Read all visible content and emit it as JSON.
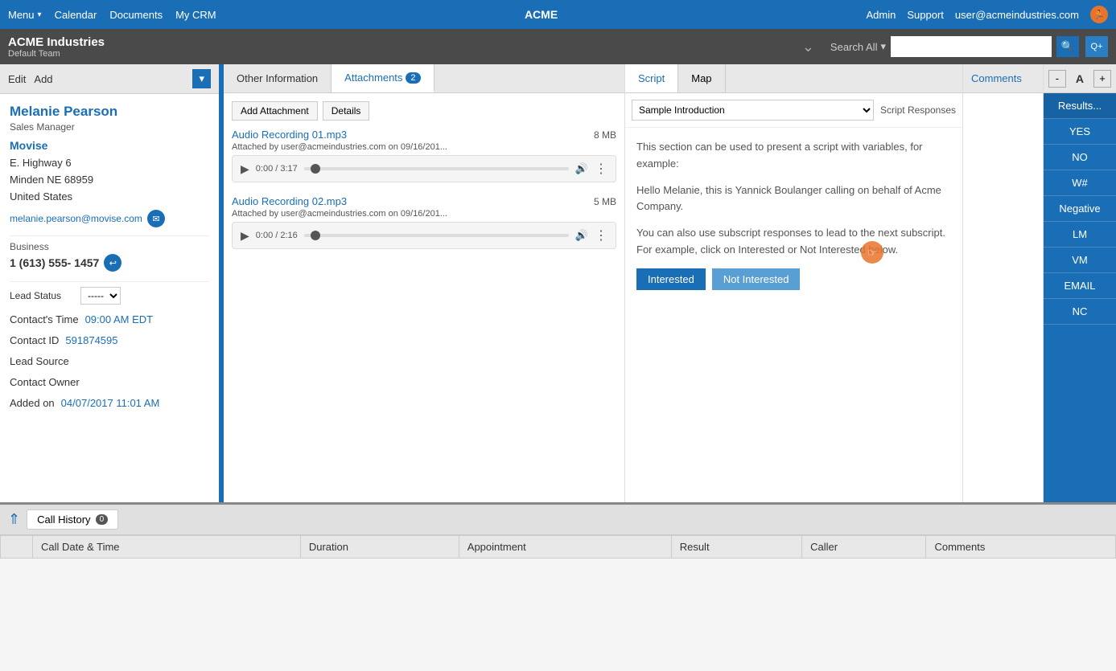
{
  "topnav": {
    "menu_label": "Menu",
    "calendar_label": "Calendar",
    "documents_label": "Documents",
    "mycrm_label": "My CRM",
    "center_label": "ACME",
    "admin_label": "Admin",
    "support_label": "Support",
    "user_label": "user@acmeindustries.com"
  },
  "secondbar": {
    "company_name": "ACME Industries",
    "team_name": "Default Team",
    "search_all_label": "Search All",
    "search_placeholder": ""
  },
  "lefttoolbar": {
    "edit_label": "Edit",
    "add_label": "Add"
  },
  "contact": {
    "name": "Melanie  Pearson",
    "title": "Sales Manager",
    "company": "Movise",
    "address_line1": "E. Highway 6",
    "address_line2": "Minden  NE  68959",
    "address_line3": "United States",
    "email": "melanie.pearson@movise.com",
    "business_label": "Business",
    "phone": "1 (613) 555- 1457",
    "lead_status_label": "Lead Status",
    "lead_status_value": "-----",
    "contacts_time_label": "Contact's Time",
    "contacts_time_value": "09:00 AM EDT",
    "contact_id_label": "Contact ID",
    "contact_id_value": "591874595",
    "lead_source_label": "Lead Source",
    "lead_source_value": "",
    "contact_owner_label": "Contact Owner",
    "contact_owner_value": "",
    "added_on_label": "Added on",
    "added_on_value": "04/07/2017 11:01 AM"
  },
  "tabs": {
    "other_info_label": "Other Information",
    "attachments_label": "Attachments",
    "attachments_count": "2"
  },
  "attachments": {
    "add_attachment_label": "Add Attachment",
    "details_label": "Details",
    "items": [
      {
        "name": "Audio Recording 01.mp3",
        "size": "8 MB",
        "meta": "Attached by user@acmeindustries.com on 09/16/201...",
        "time": "0:00 / 3:17"
      },
      {
        "name": "Audio Recording 02.mp3",
        "size": "5 MB",
        "meta": "Attached by user@acmeindustries.com on 09/16/201...",
        "time": "0:00 / 2:16"
      }
    ]
  },
  "script": {
    "tab_script_label": "Script",
    "tab_map_label": "Map",
    "dropdown_value": "Sample Introduction",
    "responses_label": "Script Responses",
    "intro_text": "This section can be used to present a script with variables, for example:",
    "body_text1": "Hello Melanie, this is Yannick Boulanger calling on behalf of Acme Company.",
    "body_text2": "You can also use subscript responses to lead to the next subscript. For example, click on Interested or Not Interested below.",
    "interested_label": "Interested",
    "not_interested_label": "Not Interested"
  },
  "comments": {
    "header_label": "Comments"
  },
  "results": {
    "header_minus": "-",
    "header_a": "A",
    "header_plus": "+",
    "items": [
      {
        "label": "Results..."
      },
      {
        "label": "YES"
      },
      {
        "label": "NO"
      },
      {
        "label": "W#"
      },
      {
        "label": "Negative"
      },
      {
        "label": "LM"
      },
      {
        "label": "VM"
      },
      {
        "label": "EMAIL"
      },
      {
        "label": "NC"
      }
    ]
  },
  "bottom": {
    "call_history_label": "Call History",
    "call_history_count": "0",
    "columns": [
      "Call Date & Time",
      "Duration",
      "Appointment",
      "Result",
      "Caller",
      "Comments"
    ]
  }
}
